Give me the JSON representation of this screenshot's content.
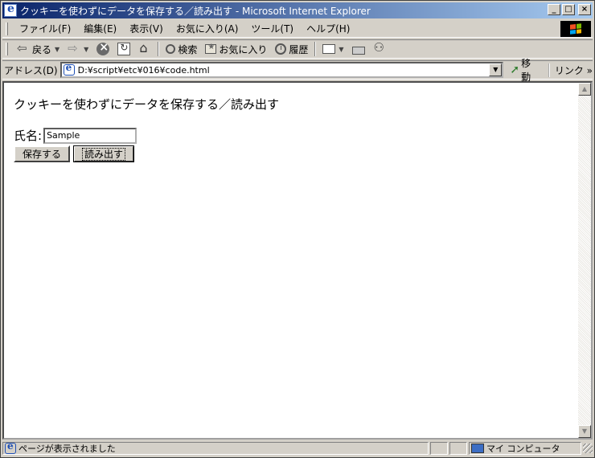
{
  "window": {
    "title": "クッキーを使わずにデータを保存する／読み出す - Microsoft Internet Explorer",
    "minimize_label": "_",
    "maximize_label": "□",
    "close_label": "×"
  },
  "menu": {
    "items": [
      "ファイル(F)",
      "編集(E)",
      "表示(V)",
      "お気に入り(A)",
      "ツール(T)",
      "ヘルプ(H)"
    ]
  },
  "toolbar": {
    "back_label": "戻る",
    "search_label": "検索",
    "favorites_label": "お気に入り",
    "history_label": "履歴"
  },
  "address": {
    "label": "アドレス(D)",
    "value": "D:¥script¥etc¥016¥code.html",
    "go_label": "移動",
    "links_label": "リンク »"
  },
  "page": {
    "heading": "クッキーを使わずにデータを保存する／読み出す",
    "name_label": "氏名:",
    "name_value": "Sample",
    "save_button": "保存する",
    "load_button": "読み出す"
  },
  "status": {
    "message": "ページが表示されました",
    "zone": "マイ コンピュータ"
  },
  "colors": {
    "titlebar_start": "#0a246a",
    "titlebar_end": "#a6caf0",
    "chrome": "#d4d0c8"
  }
}
